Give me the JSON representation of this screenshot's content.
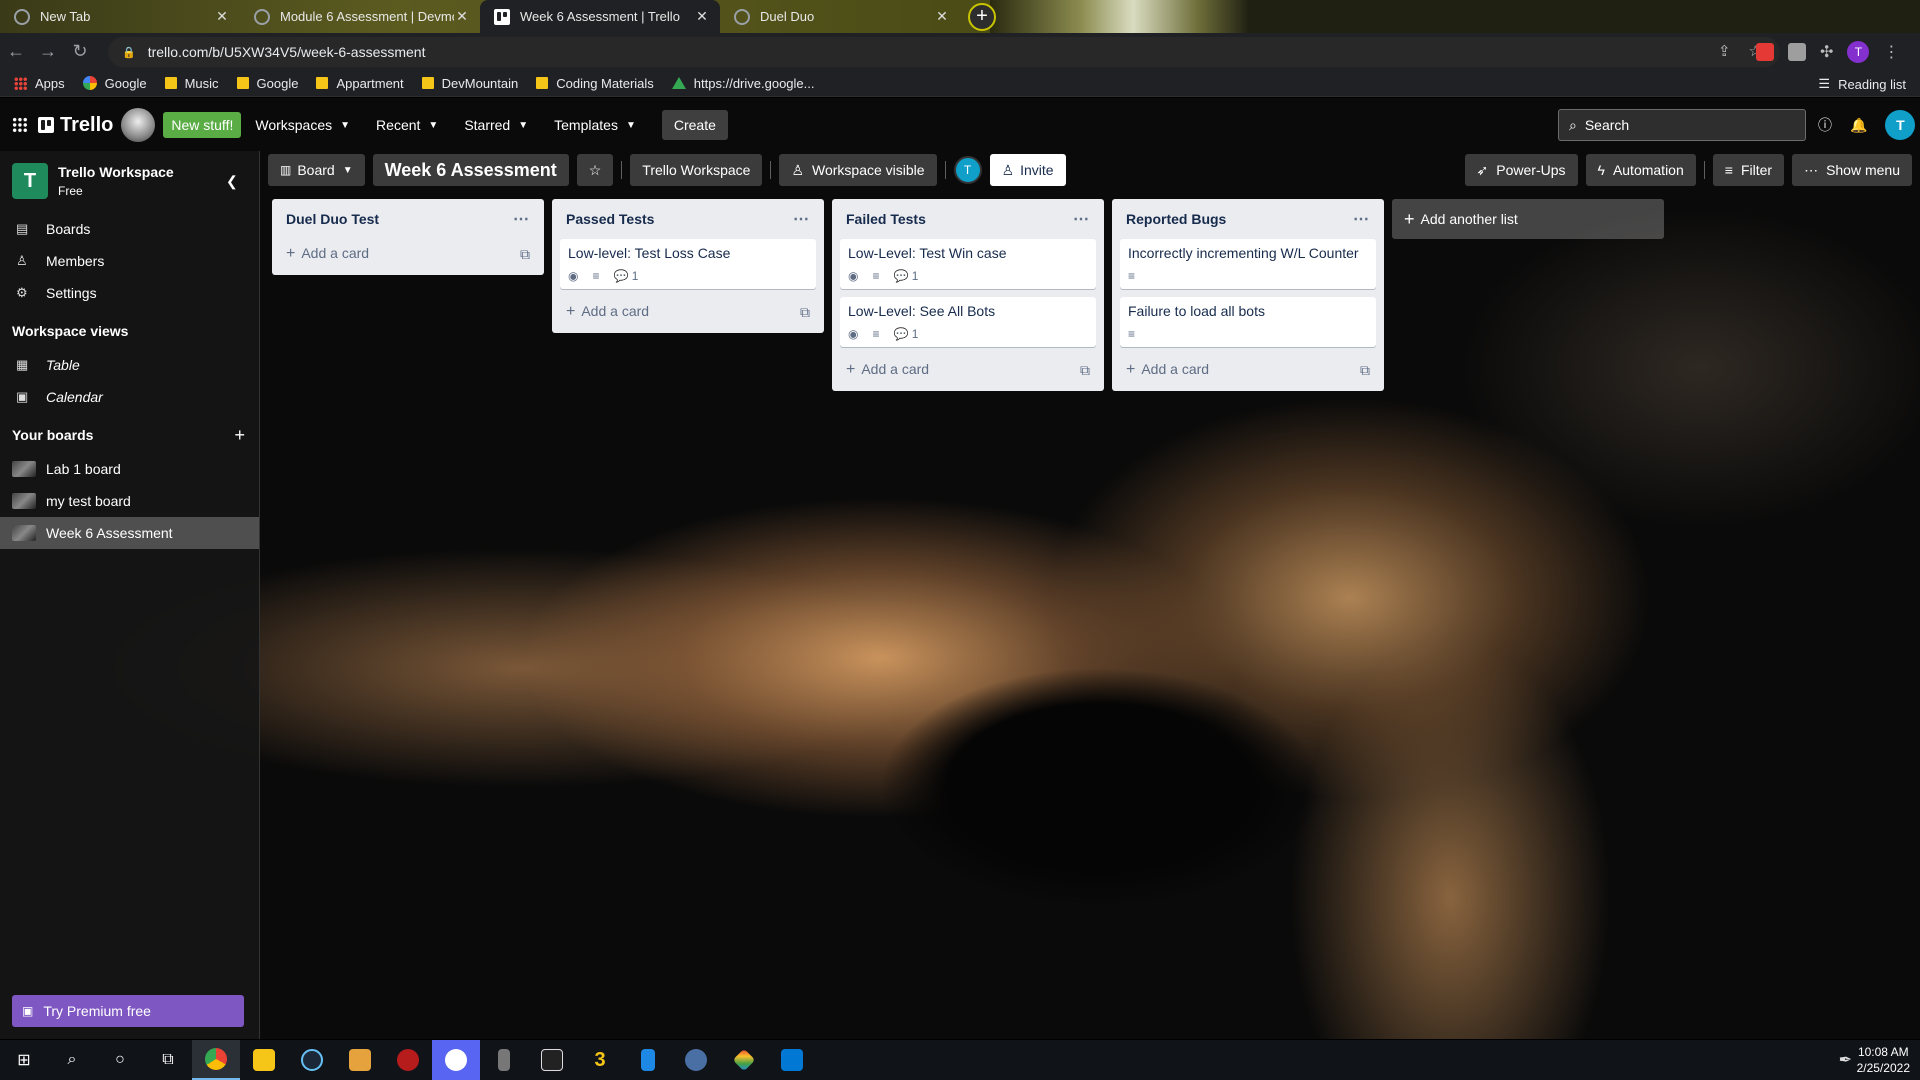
{
  "browser": {
    "tabs": [
      {
        "title": "New Tab",
        "active": false
      },
      {
        "title": "Module 6 Assessment | Devmou",
        "active": false
      },
      {
        "title": "Week 6 Assessment | Trello",
        "active": true
      },
      {
        "title": "Duel Duo",
        "active": false
      }
    ],
    "url": "trello.com/b/U5XW34V5/week-6-assessment",
    "profile_initial": "T",
    "bookmarks": [
      {
        "label": "Apps",
        "icon": "apps-icon"
      },
      {
        "label": "Google",
        "icon": "google-icon"
      },
      {
        "label": "Music",
        "icon": "folder-icon"
      },
      {
        "label": "Google",
        "icon": "folder-icon"
      },
      {
        "label": "Appartment",
        "icon": "folder-icon"
      },
      {
        "label": "DevMountain",
        "icon": "folder-icon"
      },
      {
        "label": "Coding Materials",
        "icon": "folder-icon"
      },
      {
        "label": "https://drive.google...",
        "icon": "drive-icon"
      }
    ],
    "reading_list": "Reading list"
  },
  "header": {
    "logo": "Trello",
    "new_stuff": "New stuff!",
    "menus": [
      "Workspaces",
      "Recent",
      "Starred",
      "Templates"
    ],
    "create": "Create",
    "search_placeholder": "Search",
    "user_initial": "T"
  },
  "sidebar": {
    "workspace_initial": "T",
    "workspace_name": "Trello Workspace",
    "workspace_plan": "Free",
    "items": [
      {
        "label": "Boards",
        "icon": "boards-icon"
      },
      {
        "label": "Members",
        "icon": "members-icon"
      },
      {
        "label": "Settings",
        "icon": "gear-icon"
      }
    ],
    "views_title": "Workspace views",
    "views": [
      {
        "label": "Table",
        "icon": "table-icon"
      },
      {
        "label": "Calendar",
        "icon": "calendar-icon"
      }
    ],
    "boards_title": "Your boards",
    "boards": [
      {
        "label": "Lab 1 board",
        "active": false
      },
      {
        "label": "my test board",
        "active": false
      },
      {
        "label": "Week 6 Assessment",
        "active": true
      }
    ],
    "premium": "Try Premium free"
  },
  "board": {
    "view": "Board",
    "title": "Week 6 Assessment",
    "workspace": "Trello Workspace",
    "visibility": "Workspace visible",
    "member_initial": "T",
    "invite": "Invite",
    "power_ups": "Power-Ups",
    "automation": "Automation",
    "filter": "Filter",
    "show_menu": "Show menu",
    "add_list": "Add another list",
    "add_card": "Add a card",
    "lists": [
      {
        "title": "Duel Duo Test",
        "cards": []
      },
      {
        "title": "Passed Tests",
        "cards": [
          {
            "title": "Low-level: Test Loss Case",
            "watch": true,
            "description": true,
            "comments": "1"
          }
        ]
      },
      {
        "title": "Failed Tests",
        "cards": [
          {
            "title": "Low-Level: Test Win case",
            "watch": true,
            "description": true,
            "comments": "1"
          },
          {
            "title": "Low-Level: See All Bots",
            "watch": true,
            "description": true,
            "comments": "1"
          }
        ]
      },
      {
        "title": "Reported Bugs",
        "cards": [
          {
            "title": "Incorrectly incrementing W/L Counter",
            "watch": false,
            "description": true,
            "comments": ""
          },
          {
            "title": "Failure to load all bots",
            "watch": false,
            "description": true,
            "comments": ""
          }
        ]
      }
    ]
  },
  "taskbar": {
    "time": "10:08 AM",
    "date": "2/25/2022"
  }
}
